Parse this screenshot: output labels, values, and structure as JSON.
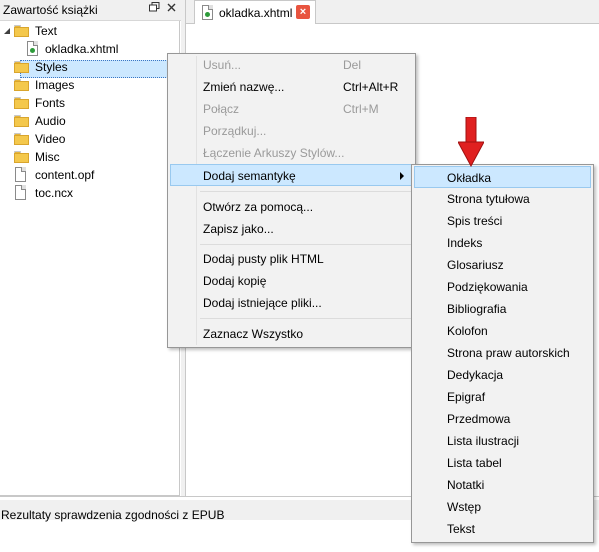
{
  "dock": {
    "title": "Zawartość książki",
    "float_icon": "float-icon",
    "close_icon": "close-icon",
    "tree": [
      {
        "label": "Text",
        "icon": "folder-icon"
      },
      {
        "label": "okladka.xhtml",
        "icon": "xhtml-file-icon"
      },
      {
        "label": "Styles",
        "icon": "folder-icon"
      },
      {
        "label": "Images",
        "icon": "folder-icon"
      },
      {
        "label": "Fonts",
        "icon": "folder-icon"
      },
      {
        "label": "Audio",
        "icon": "folder-icon"
      },
      {
        "label": "Video",
        "icon": "folder-icon"
      },
      {
        "label": "Misc",
        "icon": "folder-icon"
      },
      {
        "label": "content.opf",
        "icon": "file-icon"
      },
      {
        "label": "toc.ncx",
        "icon": "file-icon"
      }
    ]
  },
  "editor": {
    "tab_label": "okladka.xhtml",
    "tab_close": "×"
  },
  "context_menu": {
    "items": [
      {
        "label": "Usuń...",
        "shortcut": "Del",
        "disabled": true
      },
      {
        "label": "Zmień nazwę...",
        "shortcut": "Ctrl+Alt+R",
        "disabled": false
      },
      {
        "label": "Połącz",
        "shortcut": "Ctrl+M",
        "disabled": true
      },
      {
        "label": "Porządkuj...",
        "shortcut": "",
        "disabled": true
      },
      {
        "label": "Łączenie Arkuszy Stylów...",
        "shortcut": "",
        "disabled": true
      },
      {
        "label": "Dodaj semantykę",
        "shortcut": "",
        "disabled": false,
        "submenu": true
      },
      {
        "label": "Otwórz za pomocą...",
        "shortcut": "",
        "disabled": false
      },
      {
        "label": "Zapisz jako...",
        "shortcut": "",
        "disabled": false
      },
      {
        "label": "Dodaj pusty plik HTML",
        "shortcut": "",
        "disabled": false
      },
      {
        "label": "Dodaj kopię",
        "shortcut": "",
        "disabled": false
      },
      {
        "label": "Dodaj istniejące pliki...",
        "shortcut": "",
        "disabled": false
      },
      {
        "label": "Zaznacz Wszystko",
        "shortcut": "",
        "disabled": false
      }
    ]
  },
  "submenu": {
    "items": [
      "Okładka",
      "Strona tytułowa",
      "Spis treści",
      "Indeks",
      "Glosariusz",
      "Podziękowania",
      "Bibliografia",
      "Kolofon",
      "Strona praw autorskich",
      "Dedykacja",
      "Epigraf",
      "Przedmowa",
      "Lista ilustracji",
      "Lista tabel",
      "Notatki",
      "Wstęp",
      "Tekst"
    ]
  },
  "status": {
    "panel_title": "Rezultaty sprawdzenia zgodności z EPUB"
  },
  "colors": {
    "highlight": "#cce8ff",
    "arrow": "#e02020",
    "folder": "#f4c84c"
  }
}
